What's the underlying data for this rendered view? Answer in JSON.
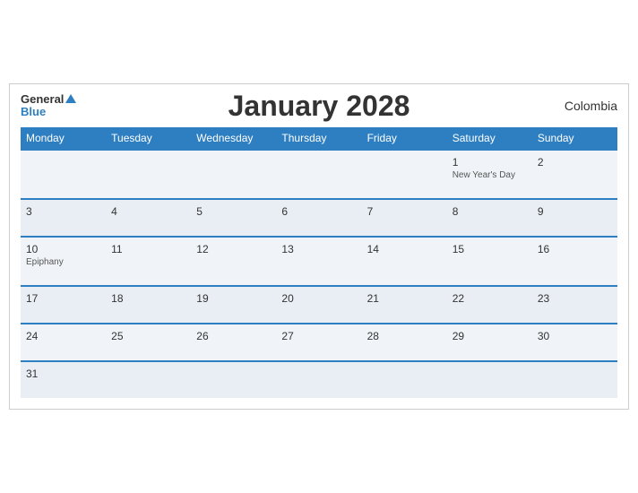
{
  "header": {
    "logo_general": "General",
    "logo_blue": "Blue",
    "title": "January 2028",
    "country": "Colombia"
  },
  "days_of_week": [
    "Monday",
    "Tuesday",
    "Wednesday",
    "Thursday",
    "Friday",
    "Saturday",
    "Sunday"
  ],
  "weeks": [
    {
      "days": [
        {
          "num": "",
          "holiday": ""
        },
        {
          "num": "",
          "holiday": ""
        },
        {
          "num": "",
          "holiday": ""
        },
        {
          "num": "",
          "holiday": ""
        },
        {
          "num": "",
          "holiday": ""
        },
        {
          "num": "1",
          "holiday": "New Year's Day"
        },
        {
          "num": "2",
          "holiday": ""
        }
      ]
    },
    {
      "days": [
        {
          "num": "3",
          "holiday": ""
        },
        {
          "num": "4",
          "holiday": ""
        },
        {
          "num": "5",
          "holiday": ""
        },
        {
          "num": "6",
          "holiday": ""
        },
        {
          "num": "7",
          "holiday": ""
        },
        {
          "num": "8",
          "holiday": ""
        },
        {
          "num": "9",
          "holiday": ""
        }
      ]
    },
    {
      "days": [
        {
          "num": "10",
          "holiday": "Epiphany"
        },
        {
          "num": "11",
          "holiday": ""
        },
        {
          "num": "12",
          "holiday": ""
        },
        {
          "num": "13",
          "holiday": ""
        },
        {
          "num": "14",
          "holiday": ""
        },
        {
          "num": "15",
          "holiday": ""
        },
        {
          "num": "16",
          "holiday": ""
        }
      ]
    },
    {
      "days": [
        {
          "num": "17",
          "holiday": ""
        },
        {
          "num": "18",
          "holiday": ""
        },
        {
          "num": "19",
          "holiday": ""
        },
        {
          "num": "20",
          "holiday": ""
        },
        {
          "num": "21",
          "holiday": ""
        },
        {
          "num": "22",
          "holiday": ""
        },
        {
          "num": "23",
          "holiday": ""
        }
      ]
    },
    {
      "days": [
        {
          "num": "24",
          "holiday": ""
        },
        {
          "num": "25",
          "holiday": ""
        },
        {
          "num": "26",
          "holiday": ""
        },
        {
          "num": "27",
          "holiday": ""
        },
        {
          "num": "28",
          "holiday": ""
        },
        {
          "num": "29",
          "holiday": ""
        },
        {
          "num": "30",
          "holiday": ""
        }
      ]
    },
    {
      "days": [
        {
          "num": "31",
          "holiday": ""
        },
        {
          "num": "",
          "holiday": ""
        },
        {
          "num": "",
          "holiday": ""
        },
        {
          "num": "",
          "holiday": ""
        },
        {
          "num": "",
          "holiday": ""
        },
        {
          "num": "",
          "holiday": ""
        },
        {
          "num": "",
          "holiday": ""
        }
      ]
    }
  ]
}
